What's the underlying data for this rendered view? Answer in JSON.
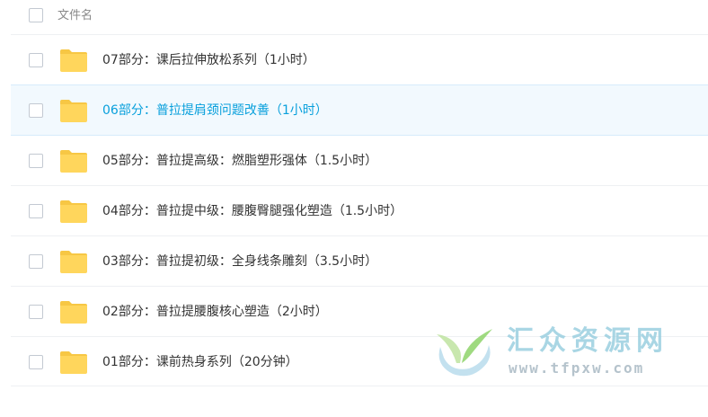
{
  "header": {
    "column_label": "文件名"
  },
  "files": [
    {
      "name": "07部分：课后拉伸放松系列（1小时）",
      "selected": false
    },
    {
      "name": "06部分：普拉提肩颈问题改善（1小时）",
      "selected": true
    },
    {
      "name": "05部分：普拉提高级：燃脂塑形强体（1.5小时）",
      "selected": false
    },
    {
      "name": "04部分：普拉提中级：腰腹臀腿强化塑造（1.5小时）",
      "selected": false
    },
    {
      "name": "03部分：普拉提初级：全身线条雕刻（3.5小时）",
      "selected": false
    },
    {
      "name": "02部分：普拉提腰腹核心塑造（2小时）",
      "selected": false
    },
    {
      "name": "01部分：课前热身系列（20分钟）",
      "selected": false
    }
  ],
  "watermark": {
    "title": "汇众资源网",
    "url": "www.tfpxw.com"
  },
  "colors": {
    "folder": "#ffd65c",
    "folder_tab": "#f7c744",
    "selected_text": "#09a0dc",
    "selected_bg": "#f2f9fe",
    "text": "#333333",
    "header_text": "#888888"
  },
  "icons": {
    "folder": "folder-icon",
    "checkbox": "checkbox-icon"
  }
}
